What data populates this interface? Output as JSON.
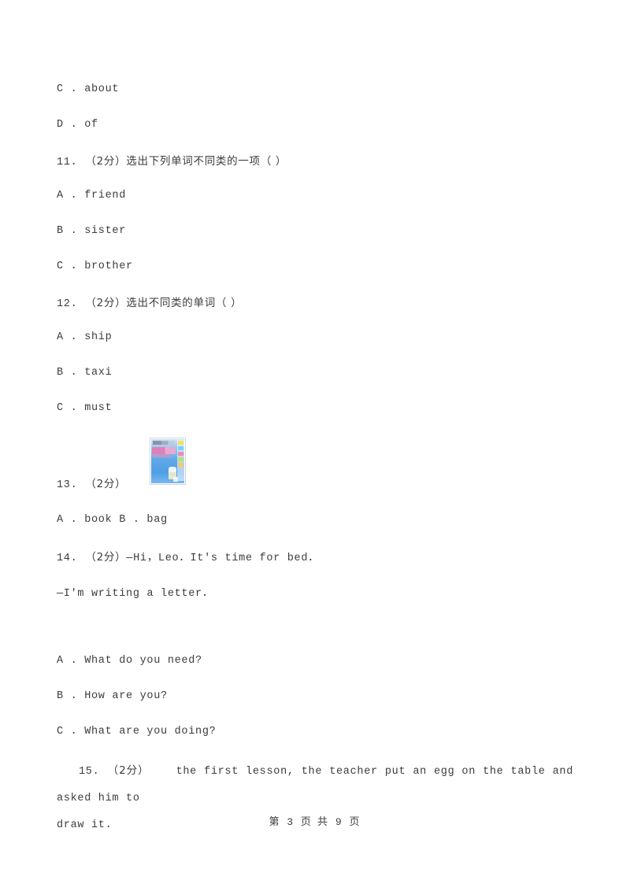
{
  "document": {
    "type": "exam-paper",
    "language": "zh-CN",
    "background_color": "#ffffff",
    "text_color": "#3c3c3c"
  },
  "carryover_options": [
    {
      "id": "opt-c-about",
      "label": "C . about"
    },
    {
      "id": "opt-d-of",
      "label": "D . of"
    }
  ],
  "questions": [
    {
      "number": "11.",
      "points": "（2分）",
      "stem": "选出下列单词不同类的一项（      ）",
      "options": [
        {
          "label": "A . friend"
        },
        {
          "label": "B . sister"
        },
        {
          "label": "C . brother"
        }
      ]
    },
    {
      "number": "12.",
      "points": "（2分）",
      "stem": "选出不同类的单词（      ）",
      "options": [
        {
          "label": "A . ship"
        },
        {
          "label": "B . taxi"
        },
        {
          "label": "C . must"
        }
      ]
    },
    {
      "number": "13.",
      "points": "（2分）",
      "stem": "",
      "image": {
        "alt": "book-cover-thumbnail",
        "description": "blue magazine or book cover with pink title band and colored side chips"
      },
      "options_inline": "A . book      B . bag"
    },
    {
      "number": "14.",
      "points": "（2分）",
      "stem_line1": "—Hi，Leo．It's time for bed．",
      "stem_line2": "—I'm writing a letter．",
      "options": [
        {
          "label": "A . What do you need?"
        },
        {
          "label": "B . How are you?"
        },
        {
          "label": "C . What are you doing?"
        }
      ]
    },
    {
      "number": "15.",
      "points": "（2分）",
      "stem_line1": "the first lesson, the teacher put an egg on the table and asked him to",
      "stem_line2": "draw it."
    }
  ],
  "footer": {
    "prefix": "第",
    "current_page": "3",
    "middle": "页 共",
    "total_pages": "9",
    "suffix": "页",
    "full_text": "第 3 页 共 9 页"
  }
}
